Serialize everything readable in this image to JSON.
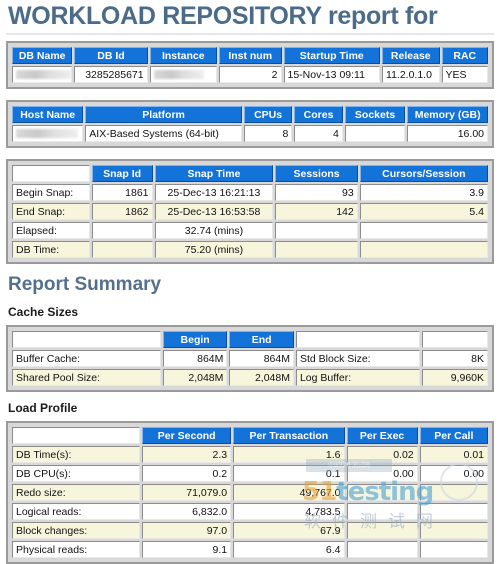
{
  "report": {
    "title": "WORKLOAD REPOSITORY report for",
    "summary_heading": "Report Summary",
    "cache_sizes_heading": "Cache Sizes",
    "load_profile_heading": "Load Profile"
  },
  "colors": {
    "header_blue": "#1473d8",
    "title_blue": "#4a6b8a",
    "alt_row": "#f7f5dc",
    "frame_gray": "#9a9a9a"
  },
  "db_table": {
    "headers": [
      "DB Name",
      "DB Id",
      "Instance",
      "Inst num",
      "Startup Time",
      "Release",
      "RAC"
    ],
    "rows": [
      {
        "db_name": "",
        "db_id": "3285285671",
        "instance": "",
        "inst_num": "2",
        "startup_time": "15-Nov-13 09:11",
        "release": "11.2.0.1.0",
        "rac": "YES"
      }
    ]
  },
  "host_table": {
    "headers": [
      "Host Name",
      "Platform",
      "CPUs",
      "Cores",
      "Sockets",
      "Memory (GB)"
    ],
    "rows": [
      {
        "host_name": "",
        "platform": "AIX-Based Systems (64-bit)",
        "cpus": "8",
        "cores": "4",
        "sockets": "",
        "memory_gb": "16.00"
      }
    ]
  },
  "snap_table": {
    "headers": [
      "",
      "Snap Id",
      "Snap Time",
      "Sessions",
      "Cursors/Session"
    ],
    "rows": [
      {
        "label": "Begin Snap:",
        "snap_id": "1861",
        "snap_time": "25-Dec-13 16:21:13",
        "sessions": "93",
        "cursors": "3.9"
      },
      {
        "label": "End Snap:",
        "snap_id": "1862",
        "snap_time": "25-Dec-13 16:53:58",
        "sessions": "142",
        "cursors": "5.4"
      },
      {
        "label": "Elapsed:",
        "snap_id": "",
        "snap_time": "32.74 (mins)",
        "sessions": "",
        "cursors": ""
      },
      {
        "label": "DB Time:",
        "snap_id": "",
        "snap_time": "75.20 (mins)",
        "sessions": "",
        "cursors": ""
      }
    ]
  },
  "cache_sizes": {
    "headers": [
      "",
      "Begin",
      "End",
      "",
      ""
    ],
    "rows": [
      {
        "label": "Buffer Cache:",
        "begin": "864M",
        "end": "864M",
        "label2": "Std Block Size:",
        "value2": "8K"
      },
      {
        "label": "Shared Pool Size:",
        "begin": "2,048M",
        "end": "2,048M",
        "label2": "Log Buffer:",
        "value2": "9,960K"
      }
    ]
  },
  "load_profile": {
    "headers": [
      "",
      "Per Second",
      "Per Transaction",
      "Per Exec",
      "Per Call"
    ],
    "rows": [
      {
        "label": "DB Time(s):",
        "per_second": "2.3",
        "per_transaction": "1.6",
        "per_exec": "0.02",
        "per_call": "0.01"
      },
      {
        "label": "DB CPU(s):",
        "per_second": "0.2",
        "per_transaction": "0.1",
        "per_exec": "0.00",
        "per_call": "0.00"
      },
      {
        "label": "Redo size:",
        "per_second": "71,079.0",
        "per_transaction": "49,767.0",
        "per_exec": "",
        "per_call": ""
      },
      {
        "label": "Logical reads:",
        "per_second": "6,832.0",
        "per_transaction": "4,783.5",
        "per_exec": "",
        "per_call": ""
      },
      {
        "label": "Block changes:",
        "per_second": "97.0",
        "per_transaction": "67.9",
        "per_exec": "",
        "per_call": ""
      },
      {
        "label": "Physical reads:",
        "per_second": "9.1",
        "per_transaction": "6.4",
        "per_exec": "",
        "per_call": ""
      }
    ]
  },
  "watermark": {
    "banner": "中国软件测试网",
    "logo_5": "5",
    "logo_1": "1",
    "logo_testing": "testing",
    "chinese": "软件测试网"
  }
}
